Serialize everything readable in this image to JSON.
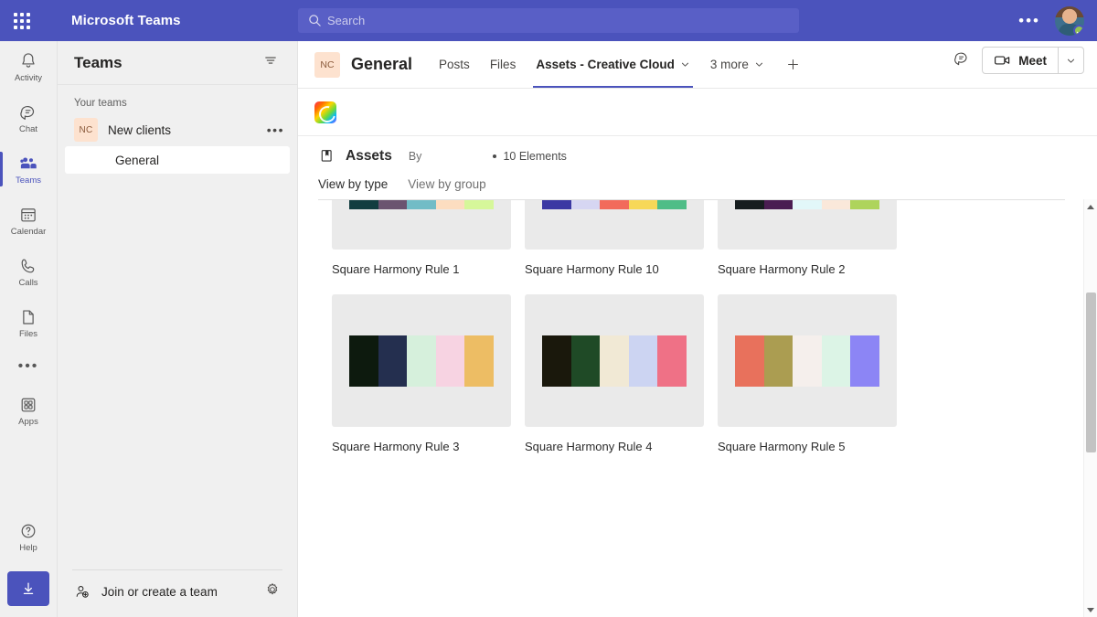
{
  "titlebar": {
    "app_title": "Microsoft Teams",
    "waffle_name": "app-launcher",
    "search_placeholder": "Search",
    "search_value": "",
    "more_label": "•••"
  },
  "rail": {
    "items": [
      {
        "label": "Activity",
        "icon": "bell-icon",
        "active": false
      },
      {
        "label": "Chat",
        "icon": "chat-icon",
        "active": false
      },
      {
        "label": "Teams",
        "icon": "teams-icon",
        "active": true
      },
      {
        "label": "Calendar",
        "icon": "calendar-icon",
        "active": false
      },
      {
        "label": "Calls",
        "icon": "phone-icon",
        "active": false
      },
      {
        "label": "Files",
        "icon": "file-icon",
        "active": false
      }
    ],
    "more_label": "•••",
    "apps": {
      "label": "Apps",
      "icon": "apps-icon"
    },
    "help": {
      "label": "Help",
      "icon": "help-icon"
    },
    "download": {
      "icon": "download-icon"
    }
  },
  "sidebar": {
    "title": "Teams",
    "filter_icon": "filter-icon",
    "section_label": "Your teams",
    "team": {
      "initials": "NC",
      "name": "New clients",
      "more_label": "•••",
      "channels": [
        {
          "name": "General",
          "selected": true
        }
      ]
    },
    "footer": {
      "join_label": "Join or create a team",
      "join_icon": "add-person-icon",
      "settings_icon": "gear-icon"
    }
  },
  "channel": {
    "initials": "NC",
    "name": "General",
    "tabs": [
      {
        "label": "Posts",
        "active": false,
        "caret": false
      },
      {
        "label": "Files",
        "active": false,
        "caret": false
      },
      {
        "label": "Assets - Creative Cloud",
        "active": true,
        "caret": true
      },
      {
        "label": "3 more",
        "active": false,
        "caret": true
      }
    ],
    "add_tab_label": "+",
    "chat_icon": "chat-bubble-icon",
    "meet_label": "Meet",
    "meet_icon": "camera-icon",
    "meet_caret_icon": "chevron-down-icon"
  },
  "app_tab": {
    "logo_name": "adobe-creative-cloud-logo"
  },
  "assets": {
    "icon": "library-icon",
    "title": "Assets",
    "by_label": "By",
    "by_name": "",
    "count_label": "10 Elements",
    "view_tabs": [
      {
        "label": "View by type",
        "active": true
      },
      {
        "label": "View by group",
        "active": false
      }
    ],
    "cards": [
      {
        "label": "Square Harmony Rule 1",
        "colors": [
          "#123d40",
          "#6b5470",
          "#72bcc6",
          "#fcddc0",
          "#d6f79a"
        ]
      },
      {
        "label": "Square Harmony Rule 10",
        "colors": [
          "#3b38a3",
          "#d6d6f2",
          "#f26b5b",
          "#f7d858",
          "#4fbd87"
        ]
      },
      {
        "label": "Square Harmony Rule 2",
        "colors": [
          "#161d1f",
          "#4a1d52",
          "#e2f7f9",
          "#fae8da",
          "#aed45c"
        ]
      },
      {
        "label": "Square Harmony Rule 3",
        "colors": [
          "#0d1a0e",
          "#242f4f",
          "#d6f0dc",
          "#f7d3e2",
          "#edbd64"
        ]
      },
      {
        "label": "Square Harmony Rule 4",
        "colors": [
          "#1a180c",
          "#1f4a26",
          "#f1e9d5",
          "#ccd4f2",
          "#ef7186"
        ]
      },
      {
        "label": "Square Harmony Rule 5",
        "colors": [
          "#e8715c",
          "#ab9d51",
          "#f5efec",
          "#dcf4e6",
          "#8c85f5"
        ]
      }
    ]
  },
  "scrollbar": {
    "up_icon": "scroll-up-arrow",
    "down_icon": "scroll-down-arrow"
  }
}
